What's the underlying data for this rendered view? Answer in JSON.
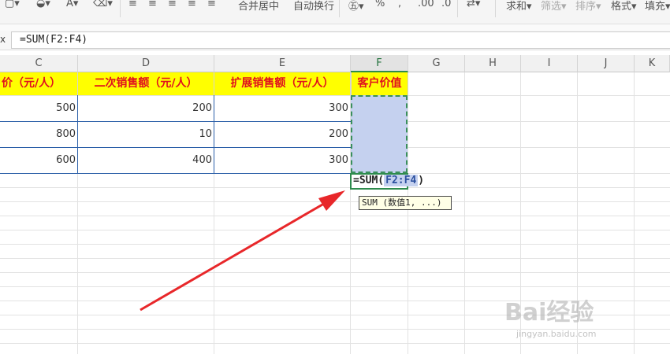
{
  "toolbar": {
    "merge_center": "合并居中",
    "auto_wrap": "自动换行",
    "sum": "求和",
    "filter": "筛选",
    "sort": "排序",
    "format": "格式",
    "fill": "填充"
  },
  "formula_bar": {
    "fx_label": "fx",
    "formula": "=SUM(F2:F4)"
  },
  "columns": [
    "C",
    "D",
    "E",
    "F",
    "G",
    "H",
    "I",
    "J",
    "K"
  ],
  "headers": {
    "c": "价（元/人）",
    "d": "二次销售额（元/人）",
    "e": "扩展销售额（元/人）",
    "f": "客户价值"
  },
  "rows": [
    {
      "c": "500",
      "d": "200",
      "e": "300"
    },
    {
      "c": "800",
      "d": "10",
      "e": "200"
    },
    {
      "c": "600",
      "d": "400",
      "e": "300"
    }
  ],
  "editing": {
    "prefix": "=SUM(",
    "ref": "F2:F4",
    "suffix": ")"
  },
  "tooltip": "SUM (数值1, ...)",
  "watermark": {
    "brand": "Bai经验",
    "url": "jingyan.baidu.com"
  },
  "colors": {
    "header_bg": "#ffff00",
    "header_text": "#e0101e",
    "selection_fill": "#c5d1ef",
    "selection_border": "#3a8f5c",
    "arrow": "#e8272a"
  }
}
